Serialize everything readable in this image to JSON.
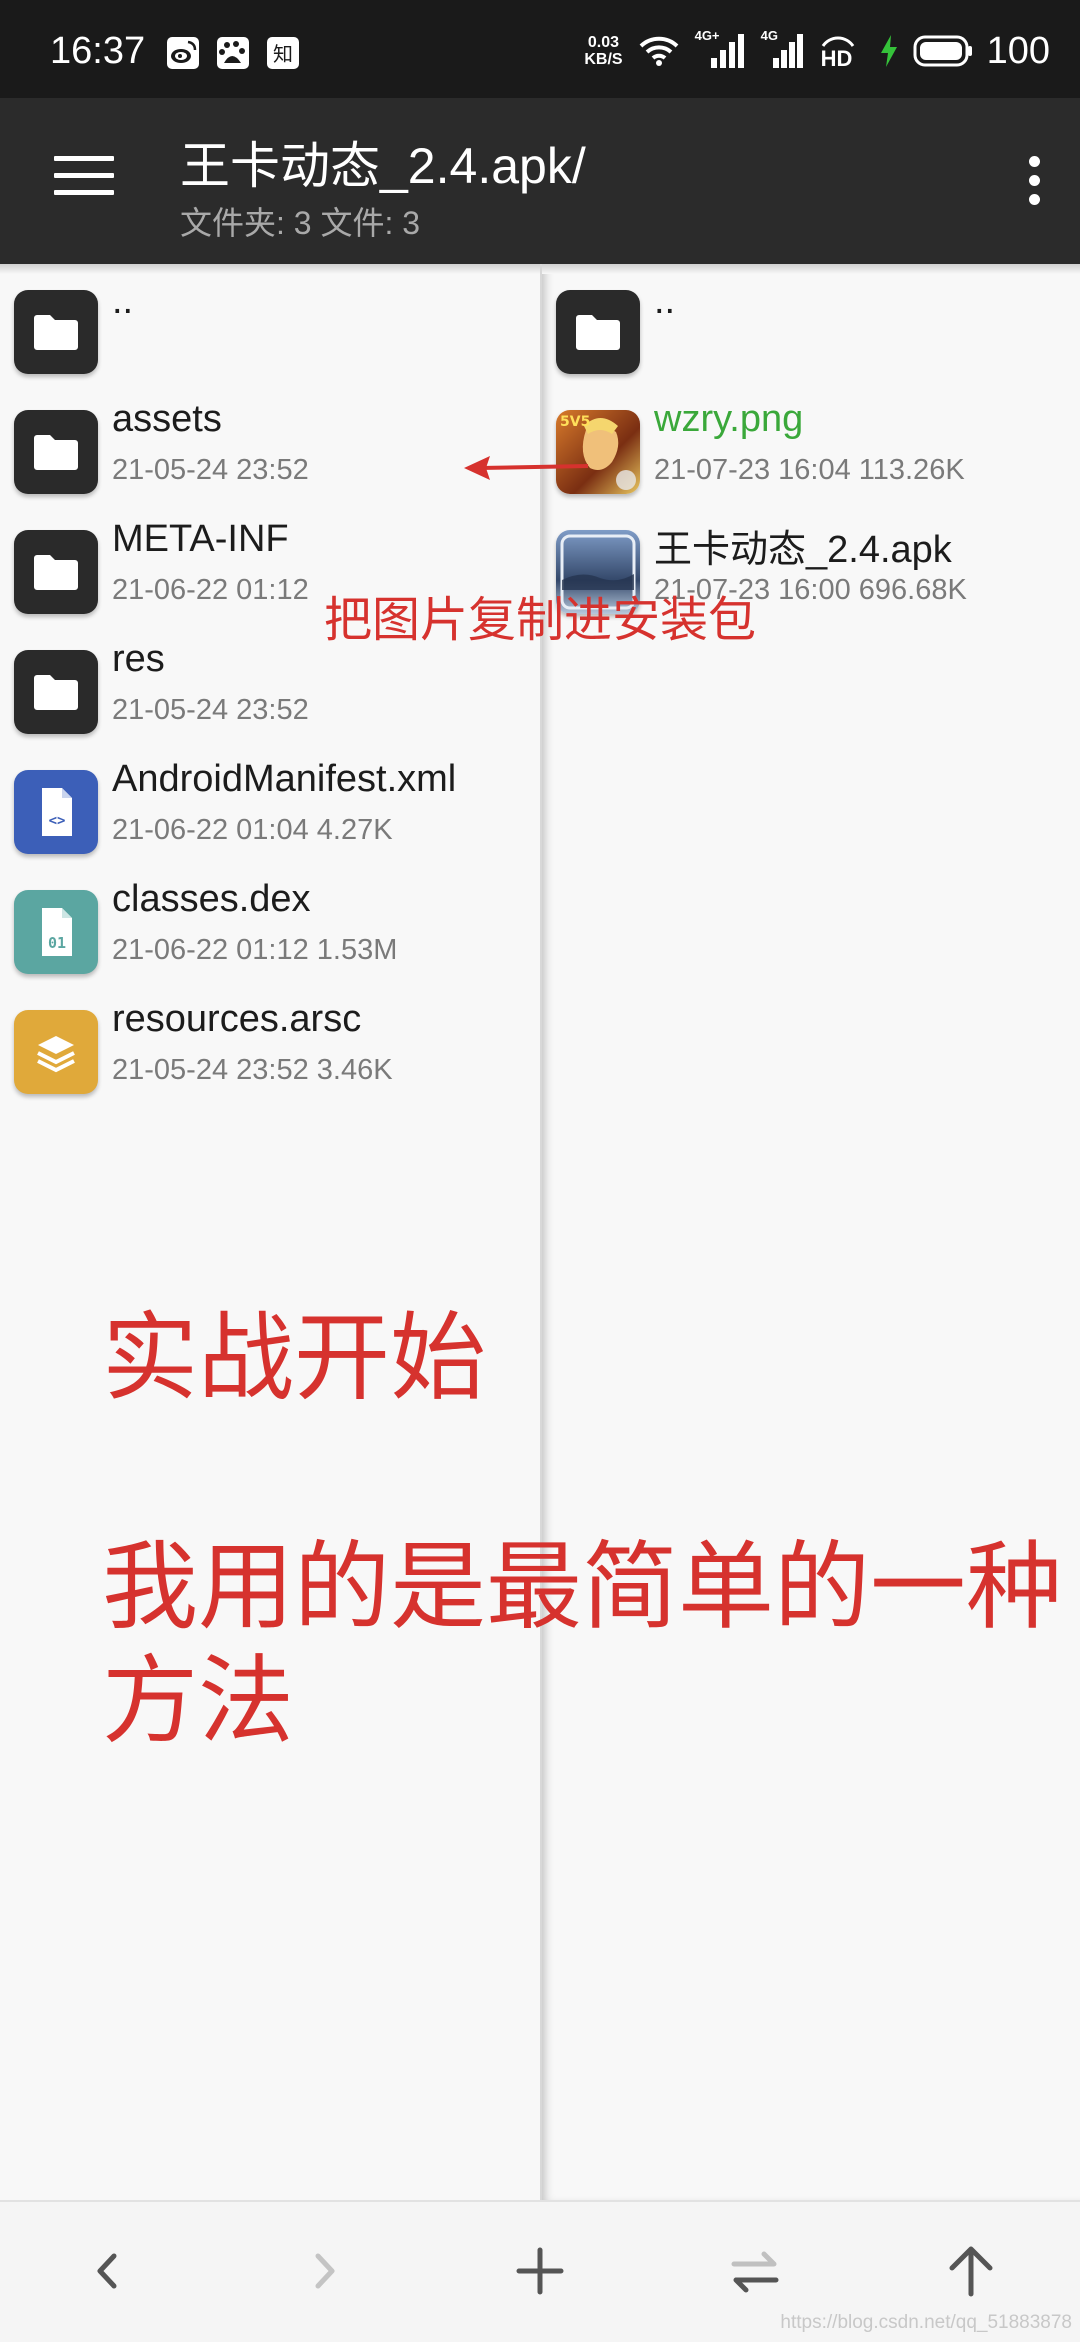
{
  "status_bar": {
    "time": "16:37",
    "app_icons": [
      "weibo-icon",
      "baidu-paw-icon",
      "zhihu-icon"
    ],
    "net_speed_value": "0.03",
    "net_speed_unit": "KB/S",
    "signal_labels": [
      "4G+",
      "4G"
    ],
    "hd_label": "HD",
    "battery": "100"
  },
  "app_bar": {
    "title": "王卡动态_2.4.apk/",
    "subtitle": "文件夹: 3  文件: 3"
  },
  "left_pane": {
    "items": [
      {
        "name": "..",
        "meta": "",
        "icon": "folder-icon"
      },
      {
        "name": "assets",
        "meta": "21-05-24 23:52",
        "icon": "folder-icon"
      },
      {
        "name": "META-INF",
        "meta": "21-06-22 01:12",
        "icon": "folder-icon"
      },
      {
        "name": "res",
        "meta": "21-05-24 23:52",
        "icon": "folder-icon"
      },
      {
        "name": "AndroidManifest.xml",
        "meta": "21-06-22 01:04  4.27K",
        "icon": "xml-file-icon"
      },
      {
        "name": "classes.dex",
        "meta": "21-06-22 01:12  1.53M",
        "icon": "dex-file-icon"
      },
      {
        "name": "resources.arsc",
        "meta": "21-05-24 23:52  3.46K",
        "icon": "arsc-file-icon"
      }
    ]
  },
  "right_pane": {
    "items": [
      {
        "name": "..",
        "meta": "",
        "icon": "folder-icon"
      },
      {
        "name": "wzry.png",
        "meta": "21-07-23 16:04  113.26K",
        "icon": "image-thumbnail",
        "name_color": "#3aa83a"
      },
      {
        "name": "王卡动态_2.4.apk",
        "meta": "21-07-23 16:00  696.68K",
        "icon": "apk-thumbnail"
      }
    ]
  },
  "annotations": {
    "copy_note": "把图片复制进安装包",
    "heading": "实战开始",
    "note": "我用的是最简单的一种方法",
    "color": "#d6322e"
  },
  "bottom_bar": {
    "buttons": [
      "back-icon",
      "forward-icon",
      "add-icon",
      "swap-icon",
      "up-icon"
    ]
  },
  "watermark": "https://blog.csdn.net/qq_51883878"
}
